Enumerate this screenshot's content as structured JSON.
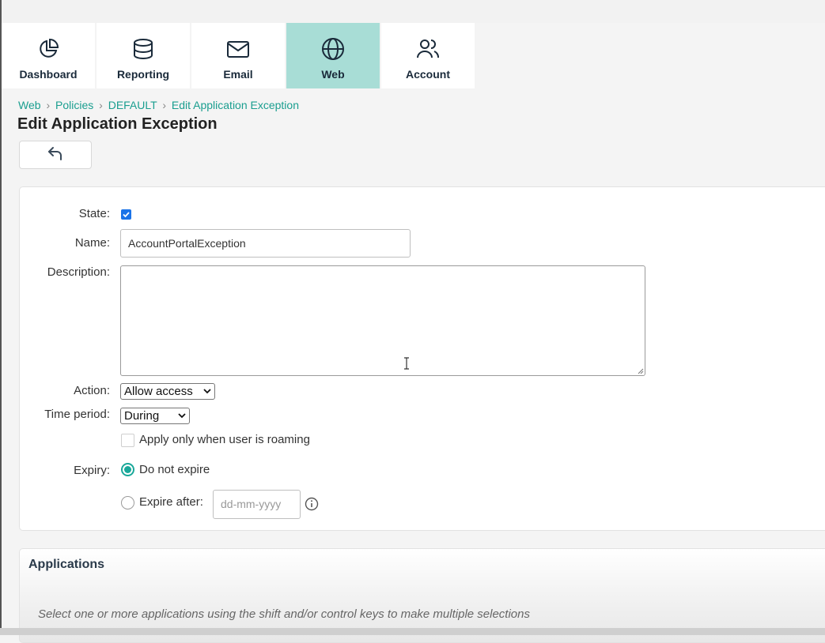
{
  "nav": {
    "tabs": [
      {
        "label": "Dashboard",
        "icon": "pie-chart-icon"
      },
      {
        "label": "Reporting",
        "icon": "database-icon"
      },
      {
        "label": "Email",
        "icon": "envelope-icon"
      },
      {
        "label": "Web",
        "icon": "globe-icon",
        "active": true
      },
      {
        "label": "Account",
        "icon": "users-icon"
      }
    ]
  },
  "breadcrumb": {
    "items": [
      "Web",
      "Policies",
      "DEFAULT",
      "Edit Application Exception"
    ],
    "separator": "›"
  },
  "page_title": "Edit Application Exception",
  "form": {
    "state_label": "State:",
    "state_checked": true,
    "name_label": "Name:",
    "name_value": "AccountPortalException",
    "description_label": "Description:",
    "description_value": "",
    "action_label": "Action:",
    "action_value": "Allow access",
    "time_period_label": "Time period:",
    "time_period_value": "During",
    "roaming_label": "Apply only when user is roaming",
    "roaming_checked": false,
    "expiry_label": "Expiry:",
    "expiry_option_never": "Do not expire",
    "expiry_option_after": "Expire after:",
    "expiry_selected": "never",
    "expiry_date_placeholder": "dd-mm-yyyy"
  },
  "applications": {
    "title": "Applications",
    "hint": "Select one or more applications using the shift and/or control keys to make multiple selections"
  },
  "colors": {
    "accent": "#1a9e8f",
    "active_tab": "#a8ddd6",
    "checkbox": "#1a73e8"
  }
}
